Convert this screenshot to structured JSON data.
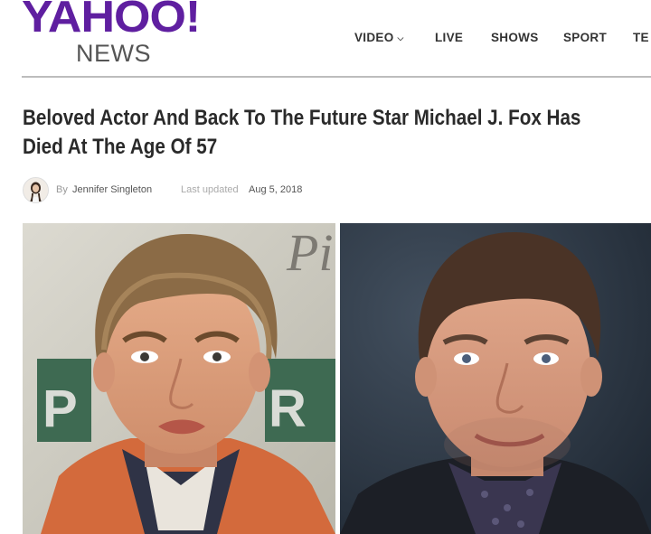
{
  "brand": {
    "logo": "YAHOO!",
    "section": "NEWS",
    "accent": "#5f1fa0"
  },
  "nav": {
    "items": [
      {
        "label": "VIDEO",
        "has_dropdown": true,
        "icon": "chevron-down-icon"
      },
      {
        "label": "LIVE"
      },
      {
        "label": "SHOWS"
      },
      {
        "label": "SPORT"
      },
      {
        "label": "TE"
      }
    ]
  },
  "article": {
    "headline_line1": "Beloved Actor And Back To The Future Star Michael J. Fox Has",
    "headline_line2": "Died At The Age Of 57",
    "by": "By",
    "author": "Jennifer Singleton",
    "updated_label": "Last updated",
    "updated_date": "Aug 5, 2018",
    "images": [
      {
        "subject": "young-actor-photo",
        "background_text": "Pi"
      },
      {
        "subject": "older-actor-photo"
      }
    ]
  }
}
